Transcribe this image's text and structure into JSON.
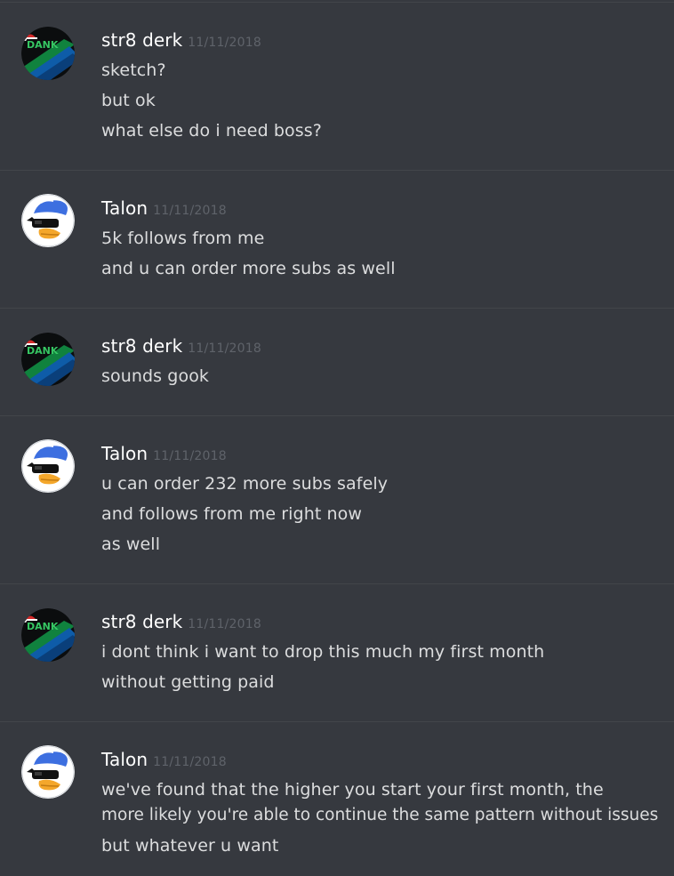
{
  "colors": {
    "background": "#36393f",
    "divider": "#42454a",
    "author_name": "#ffffff",
    "timestamp": "#5f636a",
    "message_text": "#dcddde"
  },
  "avatars": {
    "dank": {
      "text": "DANK",
      "icon": "dank-logo-avatar"
    },
    "talon": {
      "icon": "duck-sunglasses-avatar"
    }
  },
  "messages": [
    {
      "author": "str8 derk",
      "timestamp": "11/11/2018",
      "lines": [
        "sketch?",
        "but ok",
        "what else do i need boss?"
      ]
    },
    {
      "author": "Talon",
      "timestamp": "11/11/2018",
      "lines": [
        "5k follows from me",
        "and u can order more subs as well"
      ]
    },
    {
      "author": "str8 derk",
      "timestamp": "11/11/2018",
      "lines": [
        "sounds gook"
      ]
    },
    {
      "author": "Talon",
      "timestamp": "11/11/2018",
      "lines": [
        "u can order 232 more subs safely",
        "and follows from me right now",
        "as well"
      ]
    },
    {
      "author": "str8 derk",
      "timestamp": "11/11/2018",
      "lines": [
        "i dont think i want to drop this much my first month",
        "without getting paid"
      ]
    },
    {
      "author": "Talon",
      "timestamp": "11/11/2018",
      "lines": [
        "we've found that the higher you start your first month, the",
        "more likely you're able to continue the same pattern without issues",
        "but whatever u want"
      ]
    }
  ]
}
